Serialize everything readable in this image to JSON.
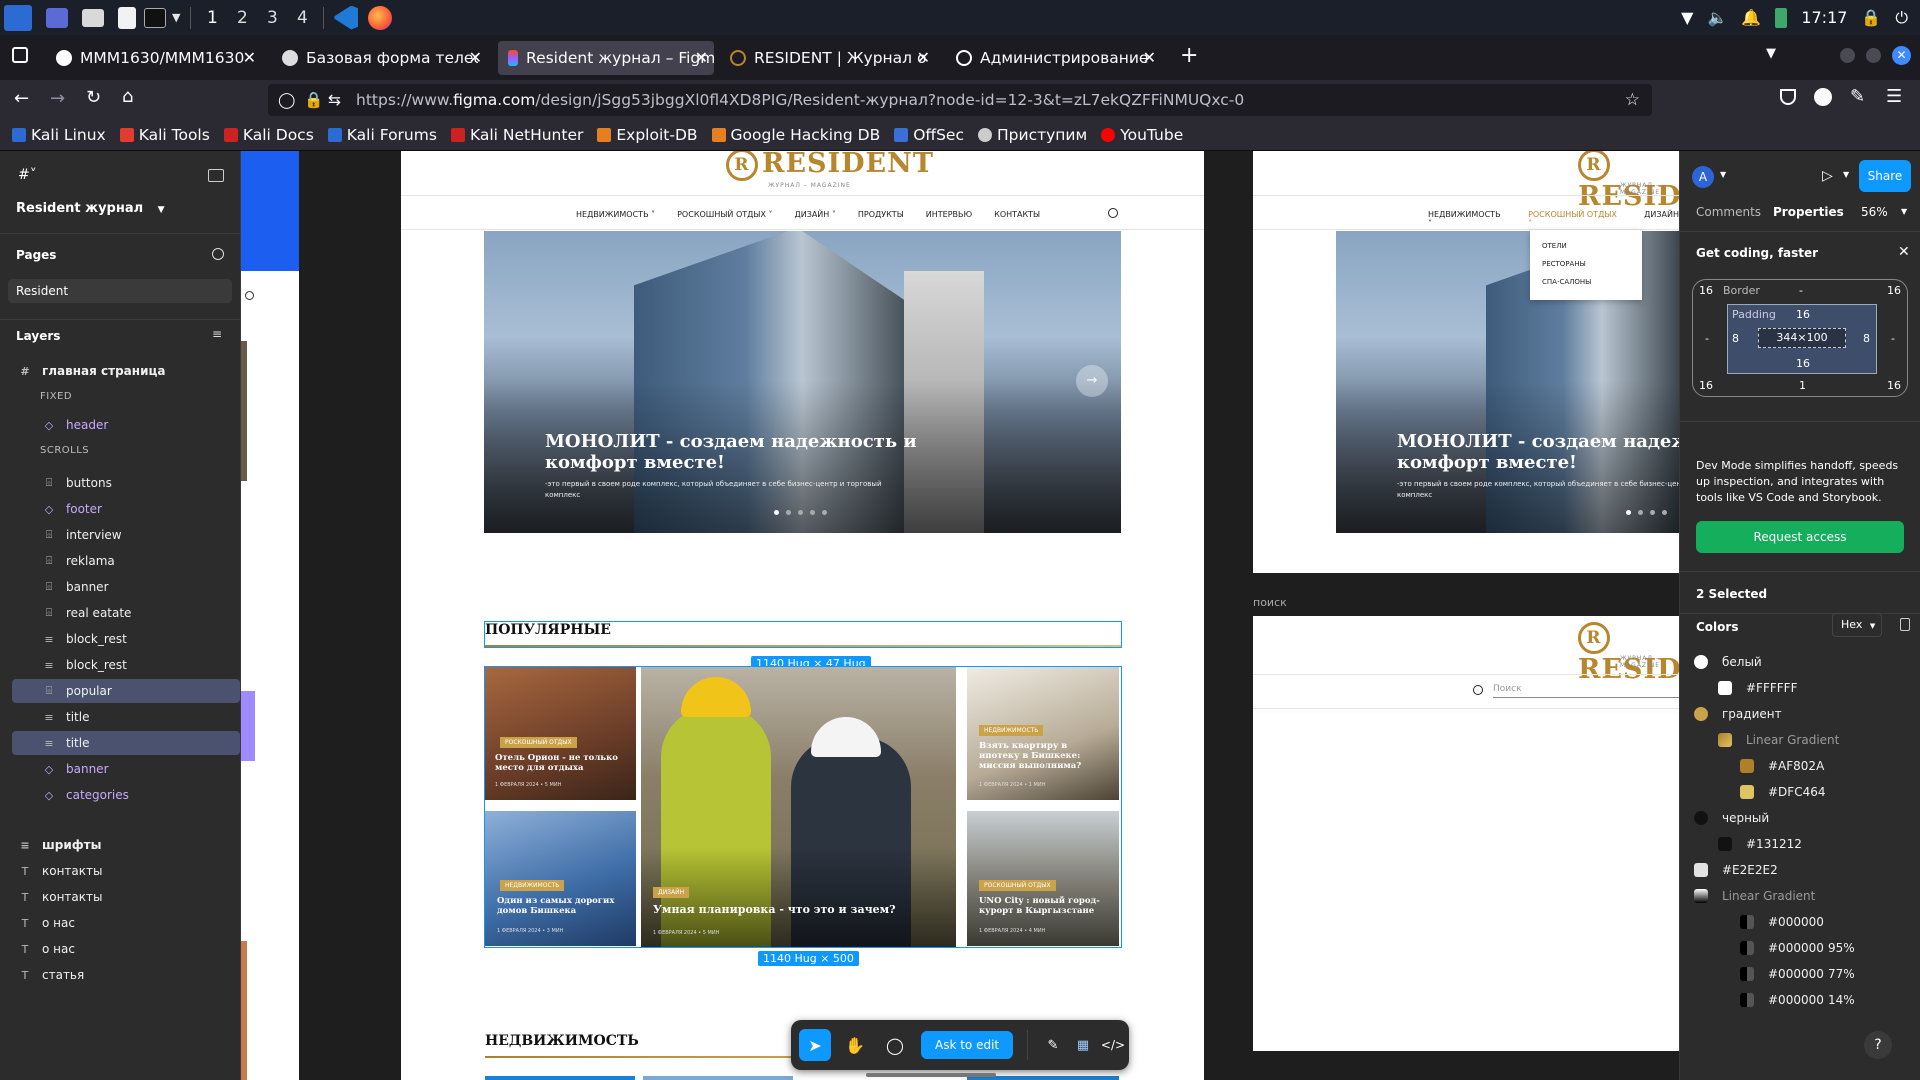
{
  "taskbar": {
    "workspaces": [
      "1",
      "2",
      "3",
      "4"
    ],
    "clock": "17:17"
  },
  "browser": {
    "tabs": [
      {
        "label": "MMM1630/MMM1630",
        "icon": "github-icon"
      },
      {
        "label": "Базовая форма телефон",
        "icon": "globe-icon"
      },
      {
        "label": "Resident журнал – Figma",
        "icon": "figma-icon",
        "active": true
      },
      {
        "label": "RESIDENT | Журнал о ро",
        "icon": "resident-icon"
      },
      {
        "label": "Администрирование сай",
        "icon": "info-icon"
      }
    ],
    "url_prefix": "https://www.",
    "url_host": "figma.com",
    "url_rest": "/design/jSgg53jbggXl0fl4XD8PIG/Resident-журнал?node-id=12-3&t=zL7ekQZFFiNMUQxc-0",
    "bookmarks": [
      "Kali Linux",
      "Kali Tools",
      "Kali Docs",
      "Kali Forums",
      "Kali NetHunter",
      "Exploit-DB",
      "Google Hacking DB",
      "OffSec",
      "Приступим",
      "YouTube"
    ]
  },
  "left_panel": {
    "file_name": "Resident журнал",
    "pages_label": "Pages",
    "current_page": "Resident",
    "layers_label": "Layers",
    "root_layer": "главная страница",
    "fixed_label": "FIXED",
    "scrolls_label": "SCROLLS",
    "layers": [
      {
        "name": "header",
        "kind": "comp"
      },
      {
        "name": "buttons",
        "kind": "frame"
      },
      {
        "name": "footer",
        "kind": "comp"
      },
      {
        "name": "interview",
        "kind": "frame"
      },
      {
        "name": "reklama",
        "kind": "frame"
      },
      {
        "name": "banner",
        "kind": "frame"
      },
      {
        "name": "real eatate",
        "kind": "frame"
      },
      {
        "name": "block_rest",
        "kind": "text"
      },
      {
        "name": "block_rest",
        "kind": "text"
      },
      {
        "name": "popular",
        "kind": "frame",
        "selected": true
      },
      {
        "name": "title",
        "kind": "text"
      },
      {
        "name": "title",
        "kind": "text",
        "selected": true
      },
      {
        "name": "banner",
        "kind": "comp"
      },
      {
        "name": "categories",
        "kind": "comp"
      }
    ],
    "top_layers": [
      {
        "name": "шрифты",
        "kind": "text"
      },
      {
        "name": "контакты",
        "kind": "T"
      },
      {
        "name": "контакты",
        "kind": "T"
      },
      {
        "name": "о нас",
        "kind": "T"
      },
      {
        "name": "о нас",
        "kind": "T"
      },
      {
        "name": "статья",
        "kind": "T"
      }
    ]
  },
  "canvas": {
    "logo": "RESIDENT",
    "logo_sub": "ЖУРНАЛ – MAGAZINE",
    "menu": [
      "НЕДВИЖИМОСТЬ",
      "РОСКОШНЫЙ ОТДЫХ",
      "ДИЗАЙН",
      "ПРОДУКТЫ",
      "ИНТЕРВЬЮ",
      "КОНТАКТЫ"
    ],
    "dropdown": [
      "ОТЕЛИ",
      "РЕСТОРАНЫ",
      "СПА-САЛОНЫ"
    ],
    "hero_title": "МОНОЛИТ - создаем надежность и комфорт вместе!",
    "hero_title_cut": "МОНОЛИТ - создаем надежн",
    "hero_title_line2": "комфорт вместе!",
    "hero_sub": "-это первый в своем роде комплекс, который объединяет в себе бизнес-центр и торговый комплекс",
    "popular_title": "ПОПУЛЯРНЫЕ",
    "realestate_title": "НЕДВИЖИМОСТЬ",
    "sel_title_dim": "1140 Hug × 47 Hug",
    "sel_block_dim": "1140 Hug × 500",
    "search_label": "поиск",
    "search_placeholder": "Поиск",
    "cards": [
      {
        "badge": "РОСКОШНЫЙ ОТДЫХ",
        "title": "Отель Орион - не только место для отдыха",
        "meta": "1 ФЕВРАЛЯ 2024  •  5 МИН"
      },
      {
        "badge": "ДИЗАЙН",
        "title": "Умная планировка - что это и зачем?",
        "meta": "1 ФЕВРАЛЯ 2024  •  5 МИН"
      },
      {
        "badge": "НЕДВИЖИМОСТЬ",
        "title": "Взять квартиру в ипотеку в Бишкеке: миссия выполнима?",
        "meta": "1 ФЕВРАЛЯ 2024  •  1 МИН"
      },
      {
        "badge": "НЕДВИЖИМОСТЬ",
        "title": "Один из самых дорогих домов Бишкека",
        "meta": "1 ФЕВРАЛЯ 2024  •  3 МИН"
      },
      {
        "badge": "РОСКОШНЫЙ ОТДЫХ",
        "title": "UNO City : новый город-курорт в Кыргызстане",
        "meta": "1 ФЕВРАЛЯ 2024  •  4 МИН"
      }
    ]
  },
  "toolbar": {
    "ask_label": "Ask to edit"
  },
  "right_panel": {
    "avatar": "A",
    "share_label": "Share",
    "tab_comments": "Comments",
    "tab_properties": "Properties",
    "zoom": "56%",
    "banner_title": "Get coding, faster",
    "box": {
      "border_label": "Border",
      "padding_label": "Padding",
      "size": "344×100",
      "outer_tl": "16",
      "outer_tr": "16",
      "outer_bl": "16",
      "outer_br": "16",
      "border_top": "-",
      "border_left": "-",
      "border_right": "-",
      "border_bottom": "1",
      "pad_top": "16",
      "pad_left": "8",
      "pad_right": "8",
      "pad_bottom": "16"
    },
    "dev_text": "Dev Mode simplifies handoff, speeds up inspection, and integrates with tools like VS Code and Storybook.",
    "request_label": "Request access",
    "selected_label": "2 Selected",
    "colors_label": "Colors",
    "format": "Hex",
    "colors": [
      {
        "label": "белый",
        "sw": "#FFFFFF",
        "type": "circle"
      },
      {
        "label": "#FFFFFF",
        "sw": "#FFFFFF",
        "type": "sub"
      },
      {
        "label": "градиент",
        "sw": "#C9A24A",
        "type": "circle"
      },
      {
        "label": "Linear Gradient",
        "sw": "#C9A24A",
        "type": "grad"
      },
      {
        "label": "#AF802A",
        "sw": "#AF802A",
        "type": "sub2"
      },
      {
        "label": "#DFC464",
        "sw": "#DFC464",
        "type": "sub2"
      },
      {
        "label": "черный",
        "sw": "#131212",
        "type": "circle"
      },
      {
        "label": "#131212",
        "sw": "#131212",
        "type": "sub"
      },
      {
        "label": "#E2E2E2",
        "sw": "#E2E2E2",
        "type": "square"
      },
      {
        "label": "Linear Gradient",
        "sw": "#000000",
        "type": "gradtop"
      },
      {
        "label": "#000000",
        "sw": "#000000",
        "type": "sub2",
        "pct": ""
      },
      {
        "label": "#000000",
        "sw": "#000000",
        "type": "sub2",
        "pct": "95%"
      },
      {
        "label": "#000000",
        "sw": "#000000",
        "type": "sub2",
        "pct": "77%"
      },
      {
        "label": "#000000",
        "sw": "#000000",
        "type": "sub2",
        "pct": "14%"
      }
    ],
    "help": "?"
  },
  "accent": "#0d99ff",
  "brand_gold": "#B8862C"
}
